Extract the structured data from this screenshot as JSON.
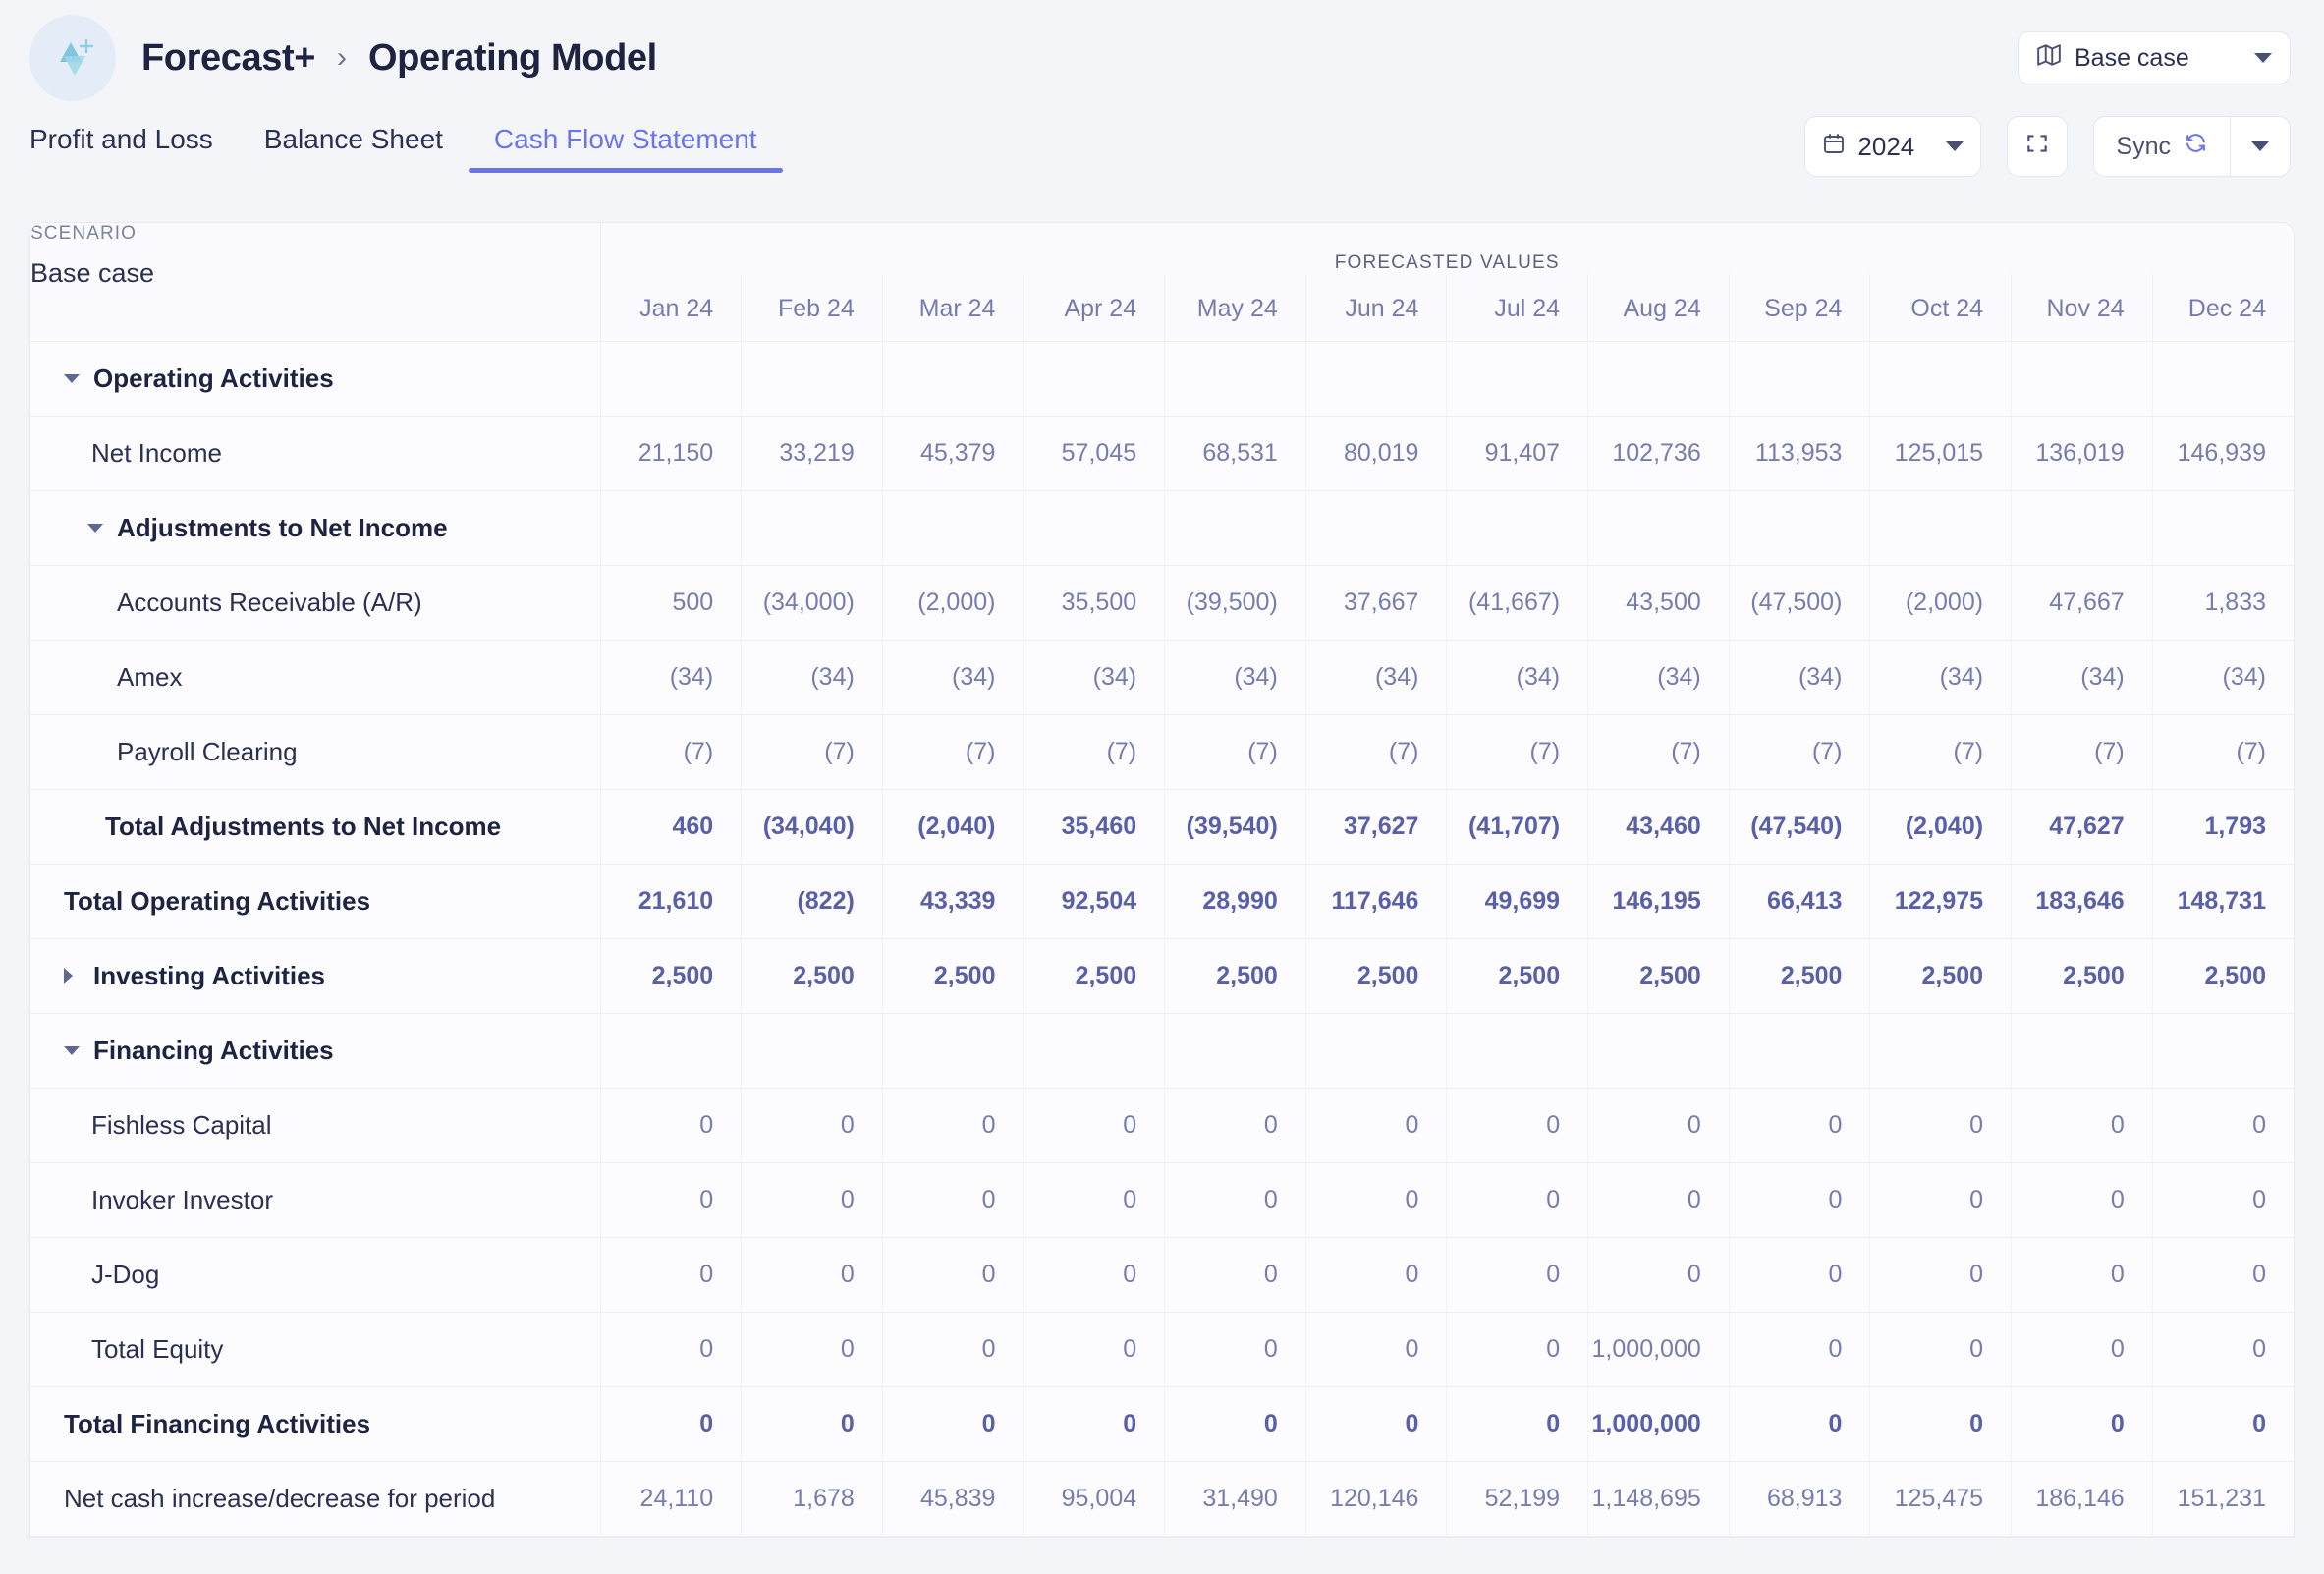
{
  "header": {
    "brand": "Forecast+",
    "separator": "›",
    "title": "Operating Model",
    "logo_icon": "forecast-plus-logo",
    "scenario_selector": {
      "icon": "map-icon",
      "label": "Base case",
      "caret_icon": "chevron-down-icon"
    }
  },
  "tabs": [
    {
      "label": "Profit and Loss",
      "active": false
    },
    {
      "label": "Balance Sheet",
      "active": false
    },
    {
      "label": "Cash Flow Statement",
      "active": true
    }
  ],
  "tools": {
    "year": {
      "icon": "calendar-icon",
      "label": "2024",
      "caret_icon": "chevron-down-icon"
    },
    "fullscreen": {
      "icon": "expand-icon"
    },
    "sync": {
      "label": "Sync",
      "icon": "refresh-icon",
      "caret_icon": "chevron-down-icon"
    }
  },
  "table": {
    "scenario_label": "SCENARIO",
    "scenario_value": "Base case",
    "band_label": "FORECASTED VALUES",
    "columns": [
      "Jan 24",
      "Feb 24",
      "Mar 24",
      "Apr 24",
      "May 24",
      "Jun 24",
      "Jul 24",
      "Aug 24",
      "Sep 24",
      "Oct 24",
      "Nov 24",
      "Dec 24"
    ],
    "rows": [
      {
        "label": "Operating Activities",
        "type": "group",
        "indent": 0,
        "toggle": "expanded",
        "values": [
          "",
          "",
          "",
          "",
          "",
          "",
          "",
          "",
          "",
          "",
          "",
          ""
        ]
      },
      {
        "label": "Net Income",
        "type": "item",
        "indent": 1,
        "toggle": "none",
        "values": [
          "21,150",
          "33,219",
          "45,379",
          "57,045",
          "68,531",
          "80,019",
          "91,407",
          "102,736",
          "113,953",
          "125,015",
          "136,019",
          "146,939"
        ]
      },
      {
        "label": "Adjustments to Net Income",
        "type": "group",
        "indent": 1,
        "toggle": "expanded",
        "values": [
          "",
          "",
          "",
          "",
          "",
          "",
          "",
          "",
          "",
          "",
          "",
          ""
        ]
      },
      {
        "label": "Accounts Receivable (A/R)",
        "type": "item",
        "indent": 2,
        "toggle": "none",
        "values": [
          "500",
          "(34,000)",
          "(2,000)",
          "35,500",
          "(39,500)",
          "37,667",
          "(41,667)",
          "43,500",
          "(47,500)",
          "(2,000)",
          "47,667",
          "1,833"
        ]
      },
      {
        "label": "Amex",
        "type": "item",
        "indent": 2,
        "toggle": "none",
        "values": [
          "(34)",
          "(34)",
          "(34)",
          "(34)",
          "(34)",
          "(34)",
          "(34)",
          "(34)",
          "(34)",
          "(34)",
          "(34)",
          "(34)"
        ]
      },
      {
        "label": "Payroll Clearing",
        "type": "item",
        "indent": 2,
        "toggle": "none",
        "values": [
          "(7)",
          "(7)",
          "(7)",
          "(7)",
          "(7)",
          "(7)",
          "(7)",
          "(7)",
          "(7)",
          "(7)",
          "(7)",
          "(7)"
        ]
      },
      {
        "label": "Total Adjustments to Net Income",
        "type": "total",
        "indent": 1,
        "toggle": "none",
        "values": [
          "460",
          "(34,040)",
          "(2,040)",
          "35,460",
          "(39,540)",
          "37,627",
          "(41,707)",
          "43,460",
          "(47,540)",
          "(2,040)",
          "47,627",
          "1,793"
        ]
      },
      {
        "label": "Total Operating Activities",
        "type": "total",
        "indent": 0,
        "toggle": "none",
        "values": [
          "21,610",
          "(822)",
          "43,339",
          "92,504",
          "28,990",
          "117,646",
          "49,699",
          "146,195",
          "66,413",
          "122,975",
          "183,646",
          "148,731"
        ]
      },
      {
        "label": "Investing Activities",
        "type": "group",
        "indent": 0,
        "toggle": "collapsed",
        "values": [
          "2,500",
          "2,500",
          "2,500",
          "2,500",
          "2,500",
          "2,500",
          "2,500",
          "2,500",
          "2,500",
          "2,500",
          "2,500",
          "2,500"
        ]
      },
      {
        "label": "Financing Activities",
        "type": "group",
        "indent": 0,
        "toggle": "expanded",
        "values": [
          "",
          "",
          "",
          "",
          "",
          "",
          "",
          "",
          "",
          "",
          "",
          ""
        ]
      },
      {
        "label": "Fishless Capital",
        "type": "item",
        "indent": 1,
        "toggle": "none",
        "values": [
          "0",
          "0",
          "0",
          "0",
          "0",
          "0",
          "0",
          "0",
          "0",
          "0",
          "0",
          "0"
        ]
      },
      {
        "label": "Invoker Investor",
        "type": "item",
        "indent": 1,
        "toggle": "none",
        "values": [
          "0",
          "0",
          "0",
          "0",
          "0",
          "0",
          "0",
          "0",
          "0",
          "0",
          "0",
          "0"
        ]
      },
      {
        "label": "J-Dog",
        "type": "item",
        "indent": 1,
        "toggle": "none",
        "values": [
          "0",
          "0",
          "0",
          "0",
          "0",
          "0",
          "0",
          "0",
          "0",
          "0",
          "0",
          "0"
        ]
      },
      {
        "label": "Total Equity",
        "type": "item",
        "indent": 1,
        "toggle": "none",
        "values": [
          "0",
          "0",
          "0",
          "0",
          "0",
          "0",
          "0",
          "1,000,000",
          "0",
          "0",
          "0",
          "0"
        ]
      },
      {
        "label": "Total Financing Activities",
        "type": "total",
        "indent": 0,
        "toggle": "none",
        "values": [
          "0",
          "0",
          "0",
          "0",
          "0",
          "0",
          "0",
          "1,000,000",
          "0",
          "0",
          "0",
          "0"
        ]
      },
      {
        "label": "Net cash increase/decrease for period",
        "type": "item",
        "indent": 0,
        "toggle": "none",
        "values": [
          "24,110",
          "1,678",
          "45,839",
          "95,004",
          "31,490",
          "120,146",
          "52,199",
          "1,148,695",
          "68,913",
          "125,475",
          "186,146",
          "151,231"
        ]
      }
    ]
  },
  "colors": {
    "accent": "#6b75e8",
    "text_dark": "#1d2340",
    "text_muted": "#767dae",
    "page_bg": "#f4f5f8"
  }
}
